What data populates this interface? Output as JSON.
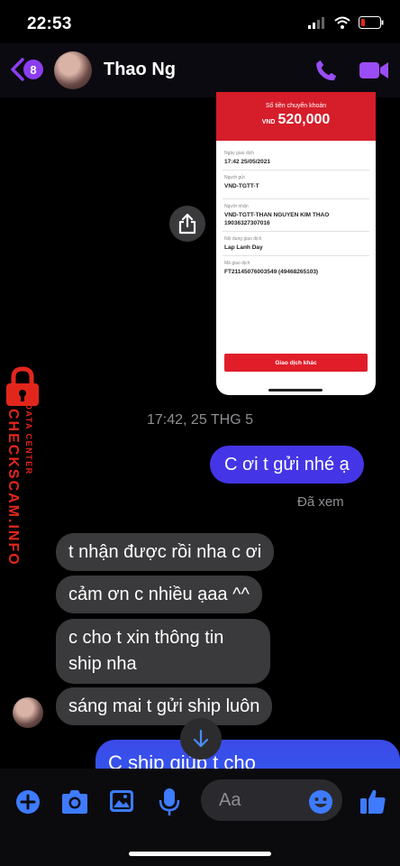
{
  "status_bar": {
    "time": "22:53"
  },
  "header": {
    "unread_count": "8",
    "contact_name": "Thao Ng"
  },
  "receipt": {
    "amount_label": "Số tiền chuyển khoản",
    "currency": "VND",
    "amount": "520,000",
    "rows": [
      {
        "label": "Ngày giao dịch",
        "value": "17:42 25/05/2021"
      },
      {
        "label": "Người gửi",
        "value": "VND-TGTT-T"
      },
      {
        "label": "Người nhận",
        "value": "VND-TGTT-THAN NGUYEN KIM THAO",
        "value2": "19036327307016"
      },
      {
        "label": "Nội dung giao dịch",
        "value": "Lap Lanh Day"
      },
      {
        "label": "Mã giao dịch",
        "value": "FT21145076003549 (49468265103)"
      }
    ],
    "button_label": "Giao dịch khác"
  },
  "watermark": {
    "brand": "CHECKSCAM.INFO",
    "sub": "DATA CENTER"
  },
  "thread": {
    "timestamp": "17:42, 25 THG 5",
    "sent_1": "C ơi t gửi nhé ạ",
    "seen_label": "Đã xem",
    "incoming": [
      "t nhận được rồi nha c ơi",
      "cảm ơn c nhiều ạaa ^^",
      "c cho t xin thông tin ship nha",
      "sáng mai t gửi ship luôn"
    ],
    "sent_2": "C ship giúp t cho"
  },
  "composer": {
    "placeholder": "Aa"
  },
  "colors": {
    "accent": "#8b3df0",
    "outgoing": "#4436e6",
    "incoming": "#3a3a3c",
    "receipt_red": "#d61d2a"
  },
  "icons": [
    "back-chevron-icon",
    "phone-icon",
    "video-camera-icon",
    "share-icon",
    "lock-icon",
    "chevron-down-icon",
    "plus-circle-icon",
    "camera-icon",
    "image-icon",
    "microphone-icon",
    "emoji-icon",
    "thumbs-up-icon"
  ]
}
